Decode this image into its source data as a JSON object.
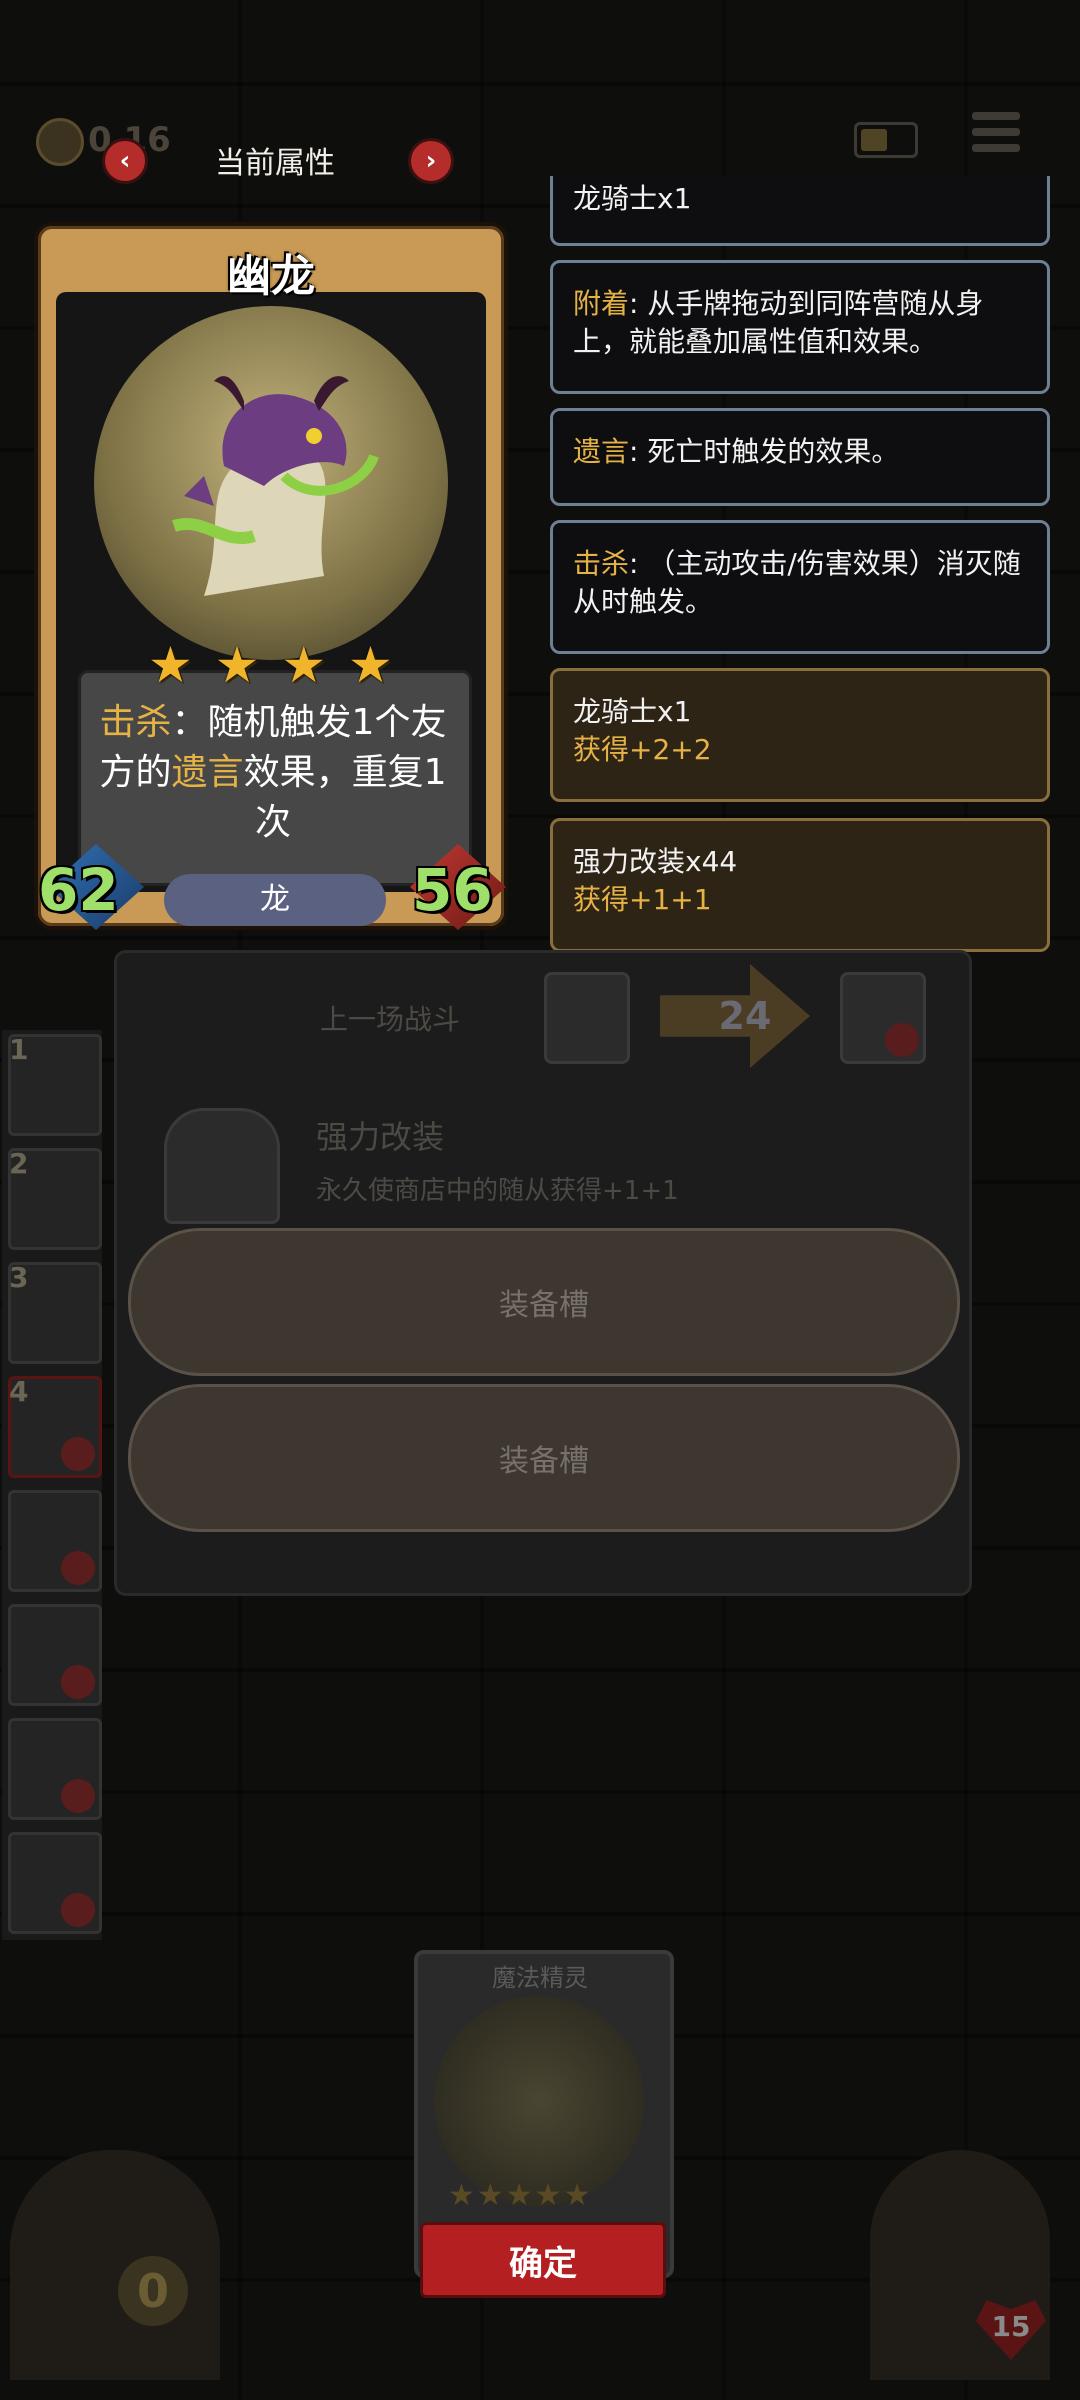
{
  "header": {
    "coin_value": "0 16",
    "title": "当前属性",
    "prev": "‹",
    "next": "›"
  },
  "card": {
    "name": "幽龙",
    "stars": 4,
    "desc_keyword1": "击杀",
    "desc_part1": "：随机触发1个友方的",
    "desc_keyword2": "遗言",
    "desc_part2": "效果，重复1次",
    "attack": "62",
    "health": "56",
    "tribe": "龙"
  },
  "info_panels": [
    {
      "line": "龙骑士x1"
    },
    {
      "keyword": "附着",
      "text": ": 从手牌拖动到同阵营随从身上，就能叠加属性值和效果。"
    },
    {
      "keyword": "遗言",
      "text": ": 死亡时触发的效果。"
    },
    {
      "keyword": "击杀",
      "text": ": （主动攻击/伤害效果）消灭随从时触发。"
    },
    {
      "title": "龙骑士x1",
      "gain": "获得+2+2"
    },
    {
      "title": "强力改装x44",
      "gain": "获得+1+1"
    }
  ],
  "battle": {
    "last_label": "上一场战斗",
    "value": "24",
    "mod_title": "强力改装",
    "mod_desc": "永久使商店中的随从获得+1+1",
    "slot1": "装备槽",
    "slot2": "装备槽"
  },
  "left_column": {
    "nums": [
      "1",
      "2",
      "3",
      "4"
    ]
  },
  "bottom": {
    "card_name": "魔法精灵",
    "stars": "★★★★★",
    "confirm": "确定",
    "zero": "0",
    "life": "15"
  },
  "colors": {
    "keyword": "#e5b245",
    "stat_green": "#9fe06a",
    "confirm_red": "#b41f22",
    "info_border": "#6f7f94"
  }
}
